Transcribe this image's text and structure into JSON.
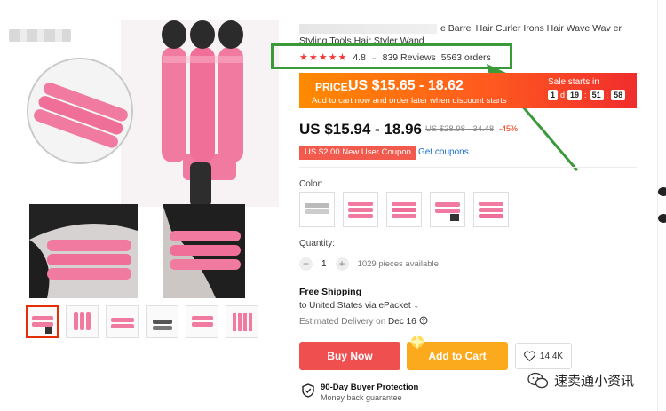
{
  "product": {
    "title_visible": "e Barrel Hair Curler Irons Hair Wave Wav er Styling Tools Hair Styler Wand",
    "rating": "4.8",
    "rating_chevron": "⌄",
    "reviews": "839 Reviews",
    "orders": "5563 orders"
  },
  "promo": {
    "price_label": "PRICE:",
    "price_range": "US $15.65 - 18.62",
    "note": "Add to cart now and order later when discount starts",
    "sale_title": "Sale starts in",
    "countdown": {
      "days": "1",
      "d_unit": "d",
      "hours": "19",
      "minutes": "51",
      "seconds": "58"
    }
  },
  "pricing": {
    "current": "US $15.94 - 18.96",
    "original": "US $28.98 - 34.48",
    "discount": "-45%",
    "coupon": "US $2.00 New User Coupon",
    "get_coupons": "Get coupons"
  },
  "variants": {
    "color_label": "Color:"
  },
  "quantity": {
    "label": "Quantity:",
    "minus": "−",
    "value": "1",
    "plus": "+",
    "available": "1029 pieces available"
  },
  "shipping": {
    "title": "Free Shipping",
    "to": "to United States via ePacket",
    "to_chevron": "⌄",
    "estimated_label": "Estimated Delivery on",
    "estimated_date": "Dec 16"
  },
  "actions": {
    "buy_now": "Buy Now",
    "add_to_cart": "Add to Cart",
    "wishlist_count": "14.4K"
  },
  "protection": {
    "title": "90-Day Buyer Protection",
    "subtitle": "Money back guarantee"
  },
  "watermark": {
    "text": "速卖通小资讯"
  },
  "colors": {
    "accent_red": "#f04f4f",
    "promo_orange": "#ff8a00",
    "cart_orange": "#fbaa1e",
    "highlight_green": "#3a9a3a",
    "product_pink": "#f07aa0"
  }
}
